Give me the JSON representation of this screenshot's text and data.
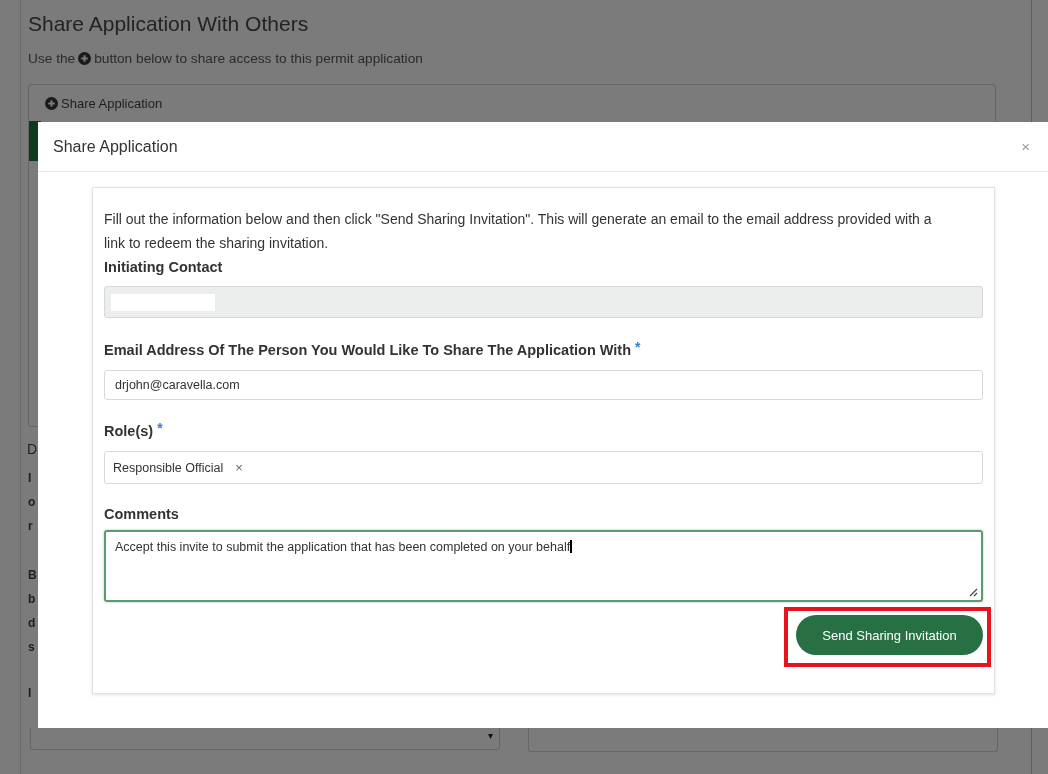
{
  "background": {
    "title": "Share Application With Others",
    "instruction_before": "Use the",
    "instruction_after": "button below to share access to this permit application",
    "share_button": "Share Application",
    "cut_texts": [
      {
        "kind": "heading",
        "text": "D"
      },
      {
        "kind": "line",
        "text": "I"
      },
      {
        "kind": "line",
        "text": "o"
      },
      {
        "kind": "line",
        "text": "r"
      },
      {
        "kind": "gap",
        "text": "B"
      },
      {
        "kind": "line",
        "text": "b"
      },
      {
        "kind": "line",
        "text": "d"
      },
      {
        "kind": "line",
        "text": "s"
      },
      {
        "kind": "label",
        "text": "I"
      }
    ],
    "select_caret": "▾"
  },
  "modal": {
    "title": "Share Application",
    "close": "×",
    "intro": "Fill out the information below and then click \"Send Sharing Invitation\". This will generate an email to the email address provided with a link to redeem the sharing invitation.",
    "fields": [
      {
        "kind": "readonly",
        "label": "Initiating Contact",
        "redacted": true
      },
      {
        "kind": "text",
        "label": "Email Address Of The Person You Would Like To Share The Application With",
        "required_mark": "*",
        "value": "drjohn@caravella.com"
      },
      {
        "kind": "tags",
        "label": "Role(s)",
        "required_mark": "*",
        "tags": [
          {
            "label": "Responsible Official",
            "remove": "×"
          }
        ]
      },
      {
        "kind": "textarea",
        "label": "Comments",
        "value": "Accept this invite to submit the application that has been completed on your behalf",
        "focused": true
      }
    ],
    "send_button": {
      "label": "Send Sharing Invitation",
      "highlighted": true
    }
  }
}
